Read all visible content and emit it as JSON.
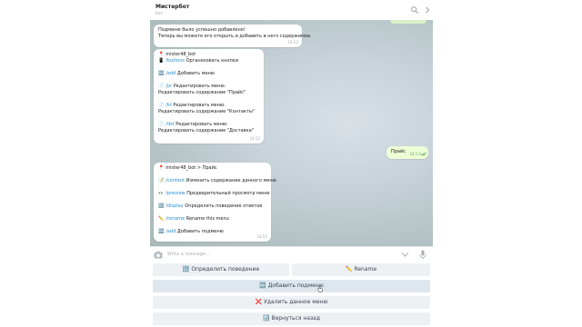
{
  "header": {
    "title": "Мистербот",
    "status": "бот",
    "search_icon": "search-icon",
    "more_icon": "chevron-right-icon"
  },
  "messages": [
    {
      "lines": [
        "Подменю было успешно добавлено!",
        "Теперь вы можете его открыть и добавить в него содержимое."
      ],
      "time": "18:52"
    },
    {
      "items": [
        {
          "emoji": "📍",
          "cmd": "",
          "text": "mister48_bot"
        },
        {
          "emoji": "📱",
          "cmd": "/buttons",
          "text": " Организовать кнопки"
        },
        {
          "emoji": "🆕",
          "cmd": "/add",
          "text": " Добавить меню"
        },
        {
          "emoji": "📄",
          "cmd": "/pr",
          "text": " Редактировать меню:",
          "sub": "Редактировать содержание \"Прайс\""
        },
        {
          "emoji": "📄",
          "cmd": "/kt",
          "text": " Редактировать меню:",
          "sub": "Редактировать содержание \"Контакты\""
        },
        {
          "emoji": "📄",
          "cmd": "/dst",
          "text": " Редактировать меню:",
          "sub": "Редактировать содержание \"Доставка\""
        }
      ],
      "time": "18:52"
    },
    {
      "out_text": "Прайс",
      "time": "18:53"
    },
    {
      "items": [
        {
          "emoji": "📍",
          "cmd": "",
          "text": "mister48_bot > Прайс"
        },
        {
          "emoji": "📝",
          "cmd": "/content",
          "text": " Изменить содержание данного меню"
        },
        {
          "emoji": "👀",
          "cmd": "/preview",
          "text": " Предварительный просмотр меню"
        },
        {
          "emoji": "🔣",
          "cmd": "/display",
          "text": " Определить поведение ответов"
        },
        {
          "emoji": "✏️",
          "cmd": "/rename",
          "text": " Rename this menu"
        },
        {
          "emoji": "🆕",
          "cmd": "/add",
          "text": " Добавить подменю"
        }
      ],
      "time": "18:53"
    }
  ],
  "input": {
    "placeholder": "Write a message...",
    "attach_icon": "camera-icon",
    "keyboard_icon": "chevron-down-icon",
    "mic_icon": "microphone-icon"
  },
  "keyboard": {
    "row1": [
      {
        "emoji": "🔣",
        "label": "Определить поведение"
      },
      {
        "emoji": "✏️",
        "label": "Rename"
      }
    ],
    "row2": {
      "emoji": "🆕",
      "label": "Добавить подменю"
    },
    "row3": {
      "emoji": "❌",
      "label": "Удалить данное меню"
    },
    "row4": {
      "emoji": "🔙",
      "label": "Вернуться назад"
    }
  },
  "colors": {
    "command_link": "#2a8fd1",
    "outgoing_bubble": "#eefed6",
    "keyboard_button": "#eef1f4"
  }
}
